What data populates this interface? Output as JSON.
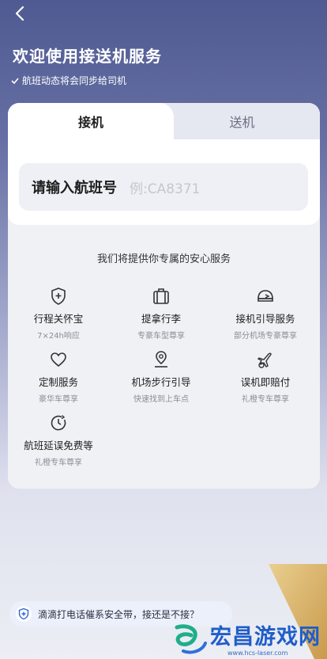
{
  "header": {
    "title": "欢迎使用接送机服务",
    "subtitle": "航班动态将会同步给司机"
  },
  "tabs": [
    {
      "label": "接机",
      "active": true
    },
    {
      "label": "送机",
      "active": false
    }
  ],
  "flight_input": {
    "label": "请输入航班号",
    "placeholder": "例:CA8371"
  },
  "services": {
    "heading": "我们将提供你专属的安心服务",
    "items": [
      {
        "name": "行程关怀宝",
        "desc": "7×24h响应",
        "icon": "shield-plus-icon"
      },
      {
        "name": "提拿行李",
        "desc": "专豪车型尊享",
        "icon": "luggage-icon"
      },
      {
        "name": "接机引导服务",
        "desc": "部分机场专豪尊享",
        "icon": "guide-sign-icon"
      },
      {
        "name": "定制服务",
        "desc": "豪华车尊享",
        "icon": "heart-icon"
      },
      {
        "name": "机场步行引导",
        "desc": "快速找到上车点",
        "icon": "location-pin-icon"
      },
      {
        "name": "误机即赔付",
        "desc": "礼橙专车尊享",
        "icon": "plane-coin-icon"
      },
      {
        "name": "航班延误免费等",
        "desc": "礼橙专车尊享",
        "icon": "clock-icon"
      }
    ]
  },
  "banner": {
    "text": "滴滴打电话催系安全带，接还是不接？"
  },
  "watermark": {
    "text": "宏昌游戏网",
    "url": "www.hcs-laser.com"
  },
  "colors": {
    "header_gradient_top": "#4f5a92",
    "brand_blue": "#1f5dc9",
    "tail_gold": "#d8b36a"
  }
}
